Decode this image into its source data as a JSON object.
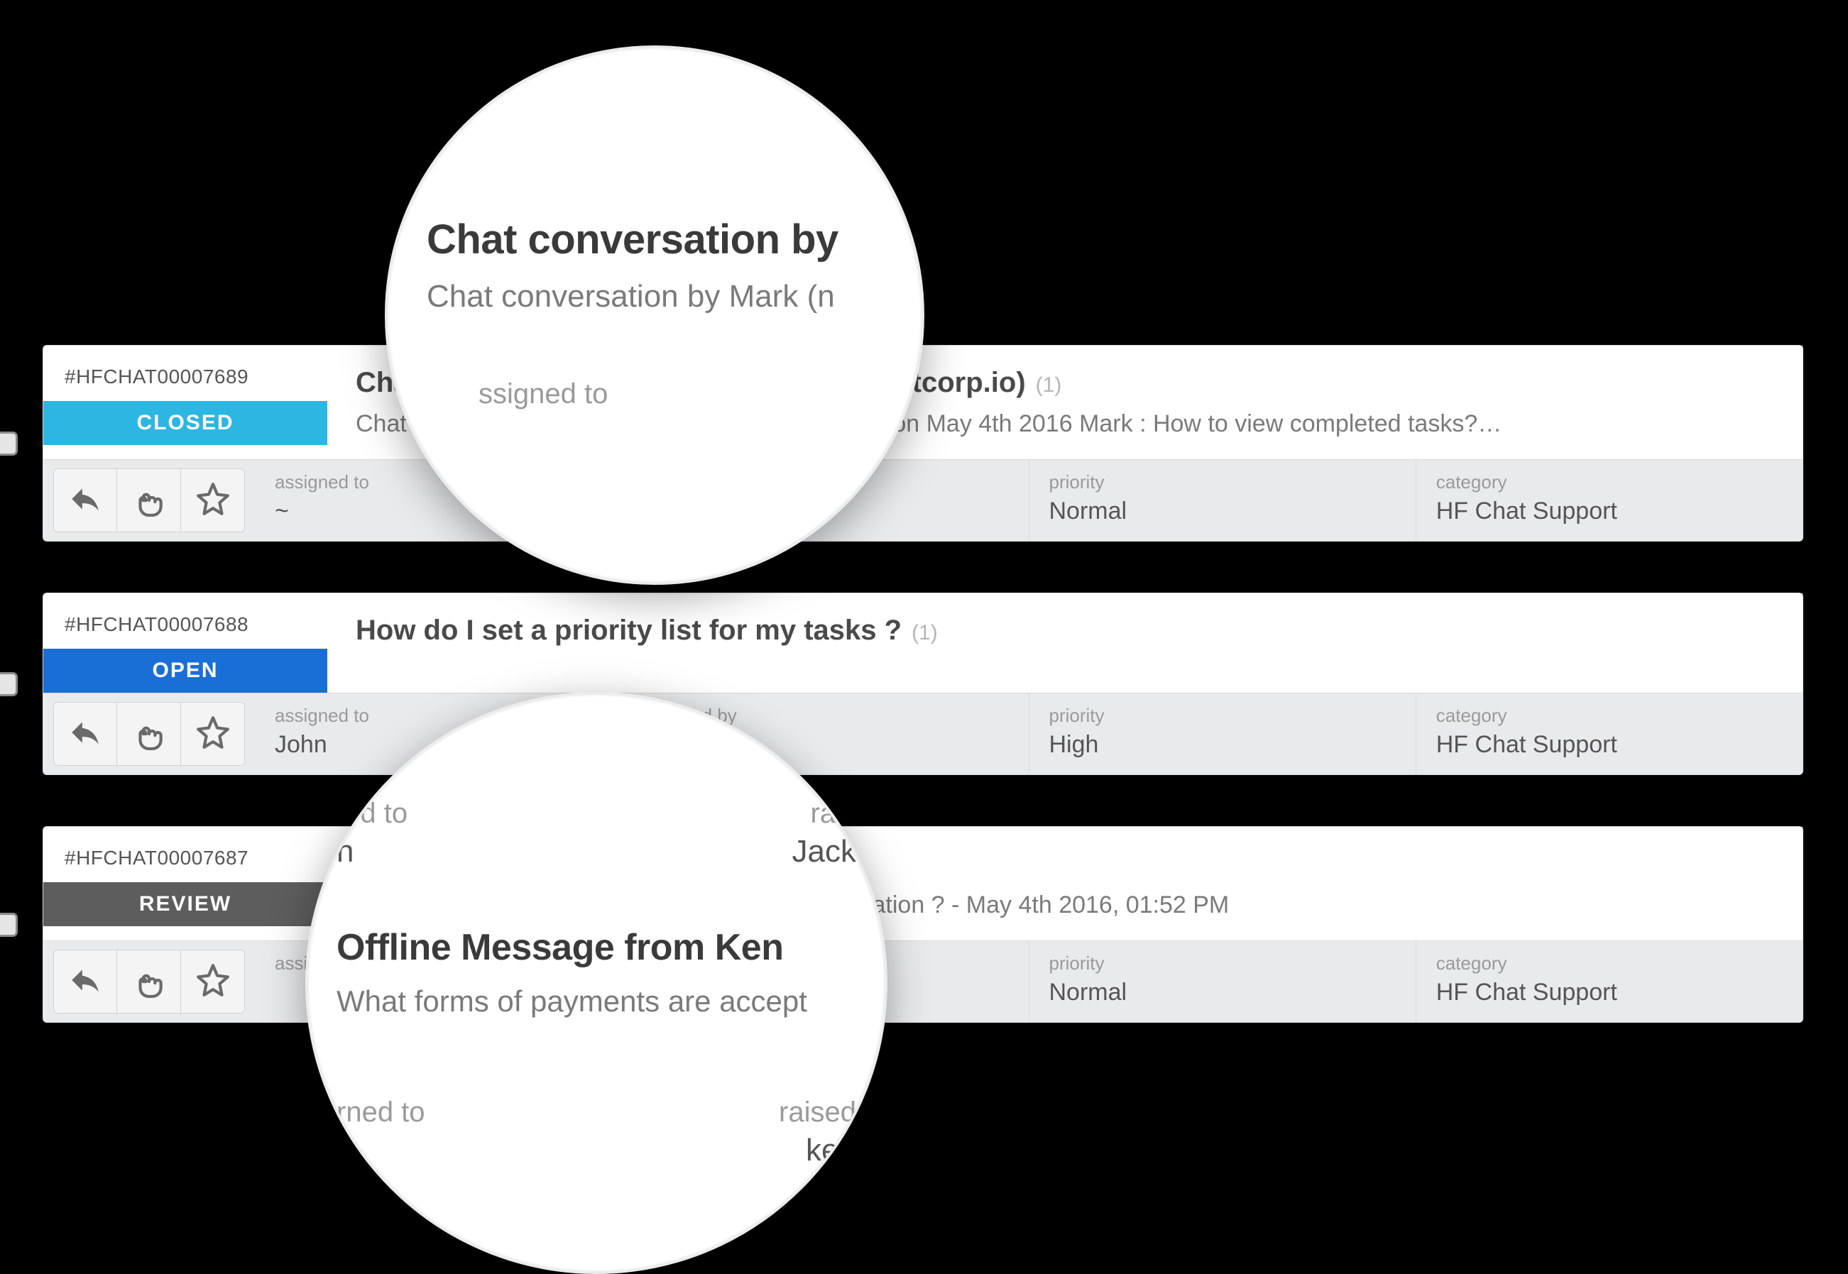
{
  "tickets": [
    {
      "id": "#HFCHAT00007689",
      "status": "CLOSED",
      "status_class": "status-closed",
      "title": "Chat conversation by Mark (mark@widgetcorp.io)",
      "count": "(1)",
      "snippet": "Chat conversation by Mark (mark@widgetcorp.io) on May 4th 2016 Mark : How to view completed tasks?…",
      "assigned_label": "assigned to",
      "assigned_value": "~",
      "raised_label": "",
      "raised_value": "",
      "priority_label": "priority",
      "priority_value": "Normal",
      "category_label": "category",
      "category_value": "HF Chat Support"
    },
    {
      "id": "#HFCHAT00007688",
      "status": "OPEN",
      "status_class": "status-open",
      "title": "How do I set a priority list for my tasks ?",
      "count": "(1)",
      "snippet": "",
      "assigned_label": "assigned to",
      "assigned_value": "John",
      "raised_label": "raised by",
      "raised_value": "Jack",
      "priority_label": "priority",
      "priority_value": "High",
      "category_label": "category",
      "category_value": "HF Chat Support"
    },
    {
      "id": "#HFCHAT00007687",
      "status": "REVIEW",
      "status_class": "status-review",
      "title": "Offline Message from Ken",
      "count": "",
      "snippet": "What forms of payments are accepted for registration ? - May 4th 2016, 01:52 PM",
      "assigned_label": "assigned to",
      "assigned_value": "",
      "raised_label": "raised by",
      "raised_value": "ken",
      "priority_label": "priority",
      "priority_value": "Normal",
      "category_label": "category",
      "category_value": "HF Chat Support"
    }
  ],
  "magnifier_top": {
    "title": "Chat conversation by",
    "sub": "Chat conversation by Mark (n",
    "meta_label": "ssigned to"
  },
  "magnifier_bottom": {
    "top_left_label": "ted to",
    "top_left_value": "n",
    "top_right_label": "rais",
    "top_right_value": "Jack",
    "title": "Offline Message from Ken",
    "sub": "What forms of payments are accept",
    "bot_left_label": "rned to",
    "bot_right_label": "raised",
    "bot_right_value": "ken"
  }
}
